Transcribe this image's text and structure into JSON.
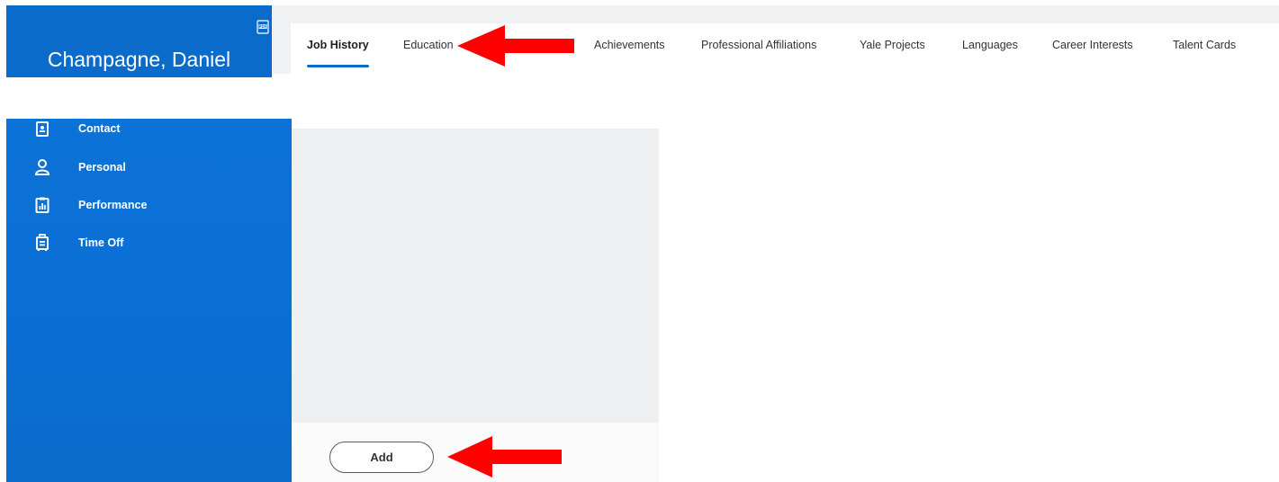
{
  "header": {
    "worker_name": "Champagne, Daniel",
    "pdf_icon": "pdf-export-icon"
  },
  "tabs": [
    {
      "label": "Job History",
      "active": true
    },
    {
      "label": "Education",
      "active": false
    },
    {
      "label": "Achievements",
      "active": false
    },
    {
      "label": "Professional Affiliations",
      "active": false
    },
    {
      "label": "Yale Projects",
      "active": false
    },
    {
      "label": "Languages",
      "active": false
    },
    {
      "label": "Career Interests",
      "active": false
    },
    {
      "label": "Talent Cards",
      "active": false
    }
  ],
  "sidebar": {
    "items": [
      {
        "label": "Contact",
        "icon": "contact-card-icon"
      },
      {
        "label": "Personal",
        "icon": "person-icon"
      },
      {
        "label": "Performance",
        "icon": "clipboard-chart-icon"
      },
      {
        "label": "Time Off",
        "icon": "luggage-icon"
      }
    ]
  },
  "footer": {
    "add_label": "Add"
  },
  "colors": {
    "brand_blue": "#0b6bcb",
    "annotation_red": "#ff0000",
    "panel_gray": "#eeeff1"
  }
}
